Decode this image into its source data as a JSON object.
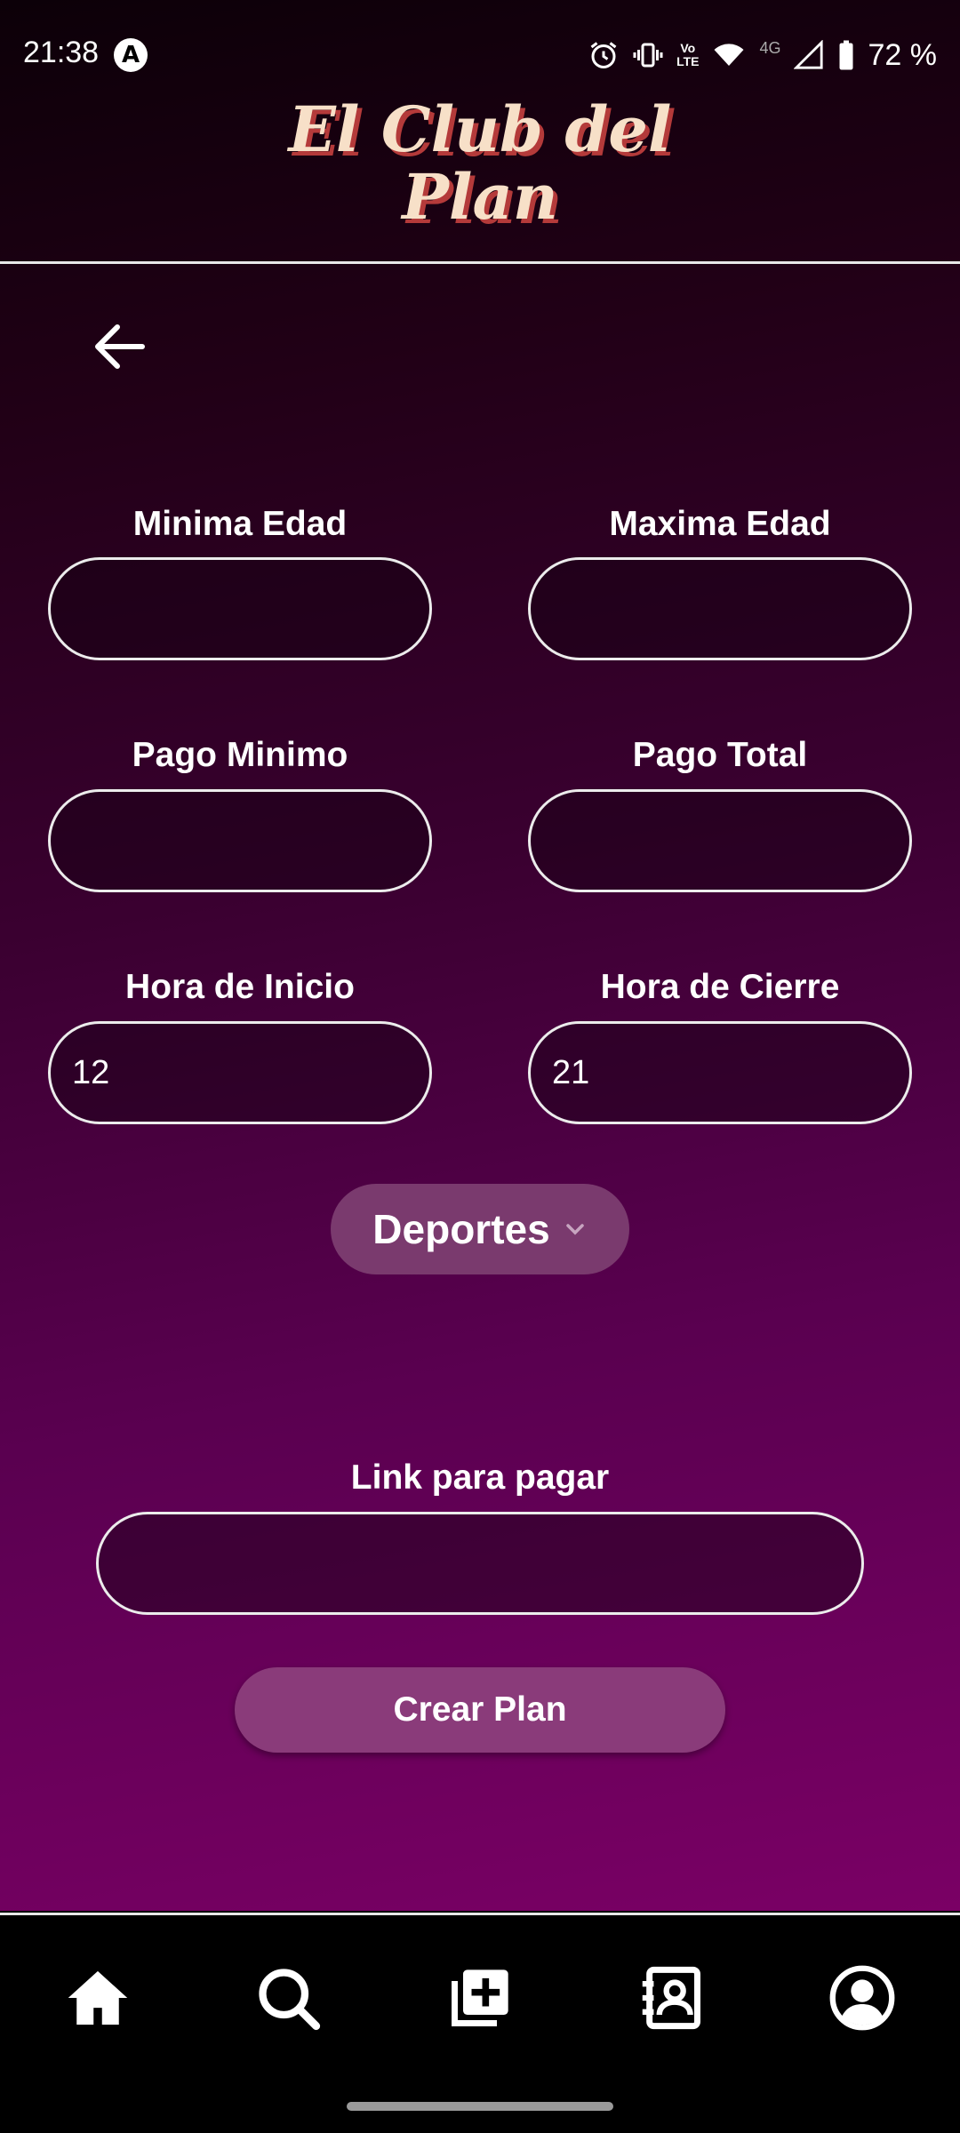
{
  "status_bar": {
    "time": "21:38",
    "app_icon_letter": "A",
    "network_label": "4G",
    "volte_top": "Vo",
    "volte_bottom": "LTE",
    "battery": "72 %"
  },
  "header": {
    "title_line1": "El Club del",
    "title_line2": "Plan"
  },
  "form": {
    "min_age": {
      "label": "Minima Edad",
      "value": ""
    },
    "max_age": {
      "label": "Maxima Edad",
      "value": ""
    },
    "min_payment": {
      "label": "Pago Minimo",
      "value": ""
    },
    "total_payment": {
      "label": "Pago Total",
      "value": ""
    },
    "start_time": {
      "label": "Hora de Inicio",
      "value": "12"
    },
    "end_time": {
      "label": "Hora de Cierre",
      "value": "21"
    },
    "category": {
      "selected": "Deportes"
    },
    "payment_link": {
      "label": "Link para pagar",
      "value": ""
    },
    "submit_label": "Crear Plan"
  },
  "bottom_nav": {
    "items": [
      "home-icon",
      "search-icon",
      "add-plan-icon",
      "contacts-icon",
      "profile-icon"
    ]
  }
}
